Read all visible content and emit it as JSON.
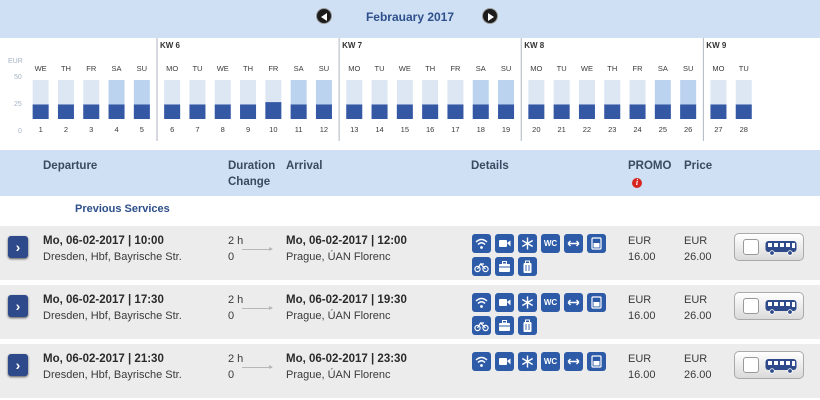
{
  "month": {
    "title": "Febrauary 2017",
    "prev_icon": "prev-month-arrow",
    "next_icon": "next-month-arrow"
  },
  "calendar": {
    "unit": "EUR",
    "y_ticks": [
      "50",
      "25",
      "0"
    ],
    "weeks": [
      {
        "label": "KW 6",
        "before_day": 6
      },
      {
        "label": "KW 7",
        "before_day": 13
      },
      {
        "label": "KW 8",
        "before_day": 20
      },
      {
        "label": "KW 9",
        "before_day": 27
      }
    ],
    "days": [
      {
        "wd": "WE",
        "d": "1",
        "weekend": false,
        "level": 0.45
      },
      {
        "wd": "TH",
        "d": "2",
        "weekend": false,
        "level": 0.45
      },
      {
        "wd": "FR",
        "d": "3",
        "weekend": false,
        "level": 0.45
      },
      {
        "wd": "SA",
        "d": "4",
        "weekend": true,
        "level": 0.45
      },
      {
        "wd": "SU",
        "d": "5",
        "weekend": true,
        "level": 0.45
      },
      {
        "wd": "MO",
        "d": "6",
        "weekend": false,
        "level": 0.45
      },
      {
        "wd": "TU",
        "d": "7",
        "weekend": false,
        "level": 0.45
      },
      {
        "wd": "WE",
        "d": "8",
        "weekend": false,
        "level": 0.45
      },
      {
        "wd": "TH",
        "d": "9",
        "weekend": false,
        "level": 0.45
      },
      {
        "wd": "FR",
        "d": "10",
        "weekend": false,
        "level": 0.55
      },
      {
        "wd": "SA",
        "d": "11",
        "weekend": true,
        "level": 0.45
      },
      {
        "wd": "SU",
        "d": "12",
        "weekend": true,
        "level": 0.45
      },
      {
        "wd": "MO",
        "d": "13",
        "weekend": false,
        "level": 0.45
      },
      {
        "wd": "TU",
        "d": "14",
        "weekend": false,
        "level": 0.45
      },
      {
        "wd": "WE",
        "d": "15",
        "weekend": false,
        "level": 0.45
      },
      {
        "wd": "TH",
        "d": "16",
        "weekend": false,
        "level": 0.45
      },
      {
        "wd": "FR",
        "d": "17",
        "weekend": false,
        "level": 0.45
      },
      {
        "wd": "SA",
        "d": "18",
        "weekend": true,
        "level": 0.45
      },
      {
        "wd": "SU",
        "d": "19",
        "weekend": true,
        "level": 0.45
      },
      {
        "wd": "MO",
        "d": "20",
        "weekend": false,
        "level": 0.45
      },
      {
        "wd": "TU",
        "d": "21",
        "weekend": false,
        "level": 0.45
      },
      {
        "wd": "WE",
        "d": "22",
        "weekend": false,
        "level": 0.45
      },
      {
        "wd": "TH",
        "d": "23",
        "weekend": false,
        "level": 0.45
      },
      {
        "wd": "FR",
        "d": "24",
        "weekend": false,
        "level": 0.45
      },
      {
        "wd": "SA",
        "d": "25",
        "weekend": true,
        "level": 0.45
      },
      {
        "wd": "SU",
        "d": "26",
        "weekend": true,
        "level": 0.45
      },
      {
        "wd": "MO",
        "d": "27",
        "weekend": false,
        "level": 0.45
      },
      {
        "wd": "TU",
        "d": "28",
        "weekend": false,
        "level": 0.45
      }
    ]
  },
  "headers": {
    "departure": "Departure",
    "duration": "Duration",
    "change": "Change",
    "arrival": "Arrival",
    "details": "Details",
    "promo": "PROMO",
    "price": "Price",
    "promo_info": "i"
  },
  "previous_services": "Previous Services",
  "connections": [
    {
      "dep_time": "Mo, 06-02-2017 | 10:00",
      "dep_place": "Dresden, Hbf, Bayrische Str.",
      "duration": "2 h",
      "change": "0",
      "arr_time": "Mo, 06-02-2017 | 12:00",
      "arr_place": "Prague, ÚAN Florenc",
      "promo_currency": "EUR",
      "promo_price": "16.00",
      "currency": "EUR",
      "price": "26.00"
    },
    {
      "dep_time": "Mo, 06-02-2017 | 17:30",
      "dep_place": "Dresden, Hbf, Bayrische Str.",
      "duration": "2 h",
      "change": "0",
      "arr_time": "Mo, 06-02-2017 | 19:30",
      "arr_place": "Prague, ÚAN Florenc",
      "promo_currency": "EUR",
      "promo_price": "16.00",
      "currency": "EUR",
      "price": "26.00"
    },
    {
      "dep_time": "Mo, 06-02-2017 | 21:30",
      "dep_place": "Dresden, Hbf, Bayrische Str.",
      "duration": "2 h",
      "change": "0",
      "arr_time": "Mo, 06-02-2017 | 23:30",
      "arr_place": "Prague, ÚAN Florenc",
      "promo_currency": "EUR",
      "promo_price": "16.00",
      "currency": "EUR",
      "price": "26.00"
    }
  ],
  "amenities": [
    "wifi-icon",
    "video-icon",
    "air-conditioning-icon",
    "wc-icon",
    "transfer-icon",
    "drink-icon",
    "bicycle-icon",
    "luggage-icon",
    "baggage-icon"
  ],
  "amenity_wc_label": "WC",
  "colors": {
    "accent": "#2e5ba8",
    "header_bg": "#cfe0f5",
    "bar": "#3558a5",
    "bar_bg": "#dde7f3",
    "weekend_bg": "#bcd3f0"
  }
}
